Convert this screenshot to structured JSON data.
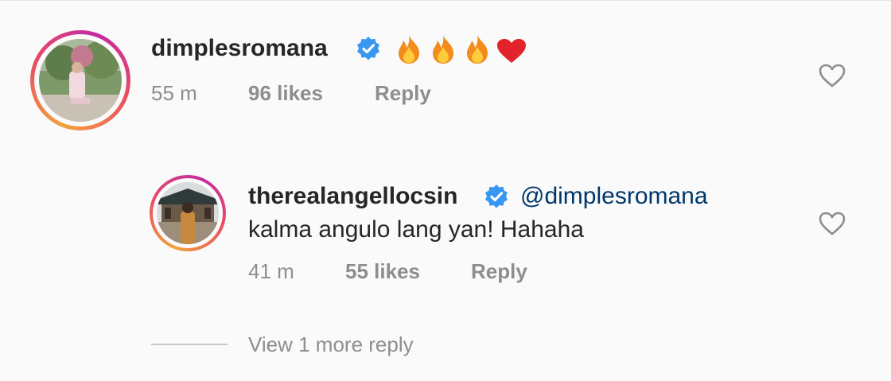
{
  "comment": {
    "username": "dimplesromana",
    "time": "55 m",
    "likes": "96 likes",
    "reply_label": "Reply",
    "emojis": [
      "fire-icon",
      "fire-icon",
      "fire-icon",
      "red-heart-icon"
    ]
  },
  "reply": {
    "username": "therealangellocsin",
    "mention": "@dimplesromana",
    "text": "kalma angulo lang yan! Hahaha",
    "time": "41 m",
    "likes": "55 likes",
    "reply_label": "Reply"
  },
  "view_more_label": "View 1 more reply",
  "colors": {
    "verified_blue": "#3897f0",
    "mention_blue": "#00376b",
    "meta_gray": "#8e8e8e",
    "text_dark": "#262626"
  }
}
